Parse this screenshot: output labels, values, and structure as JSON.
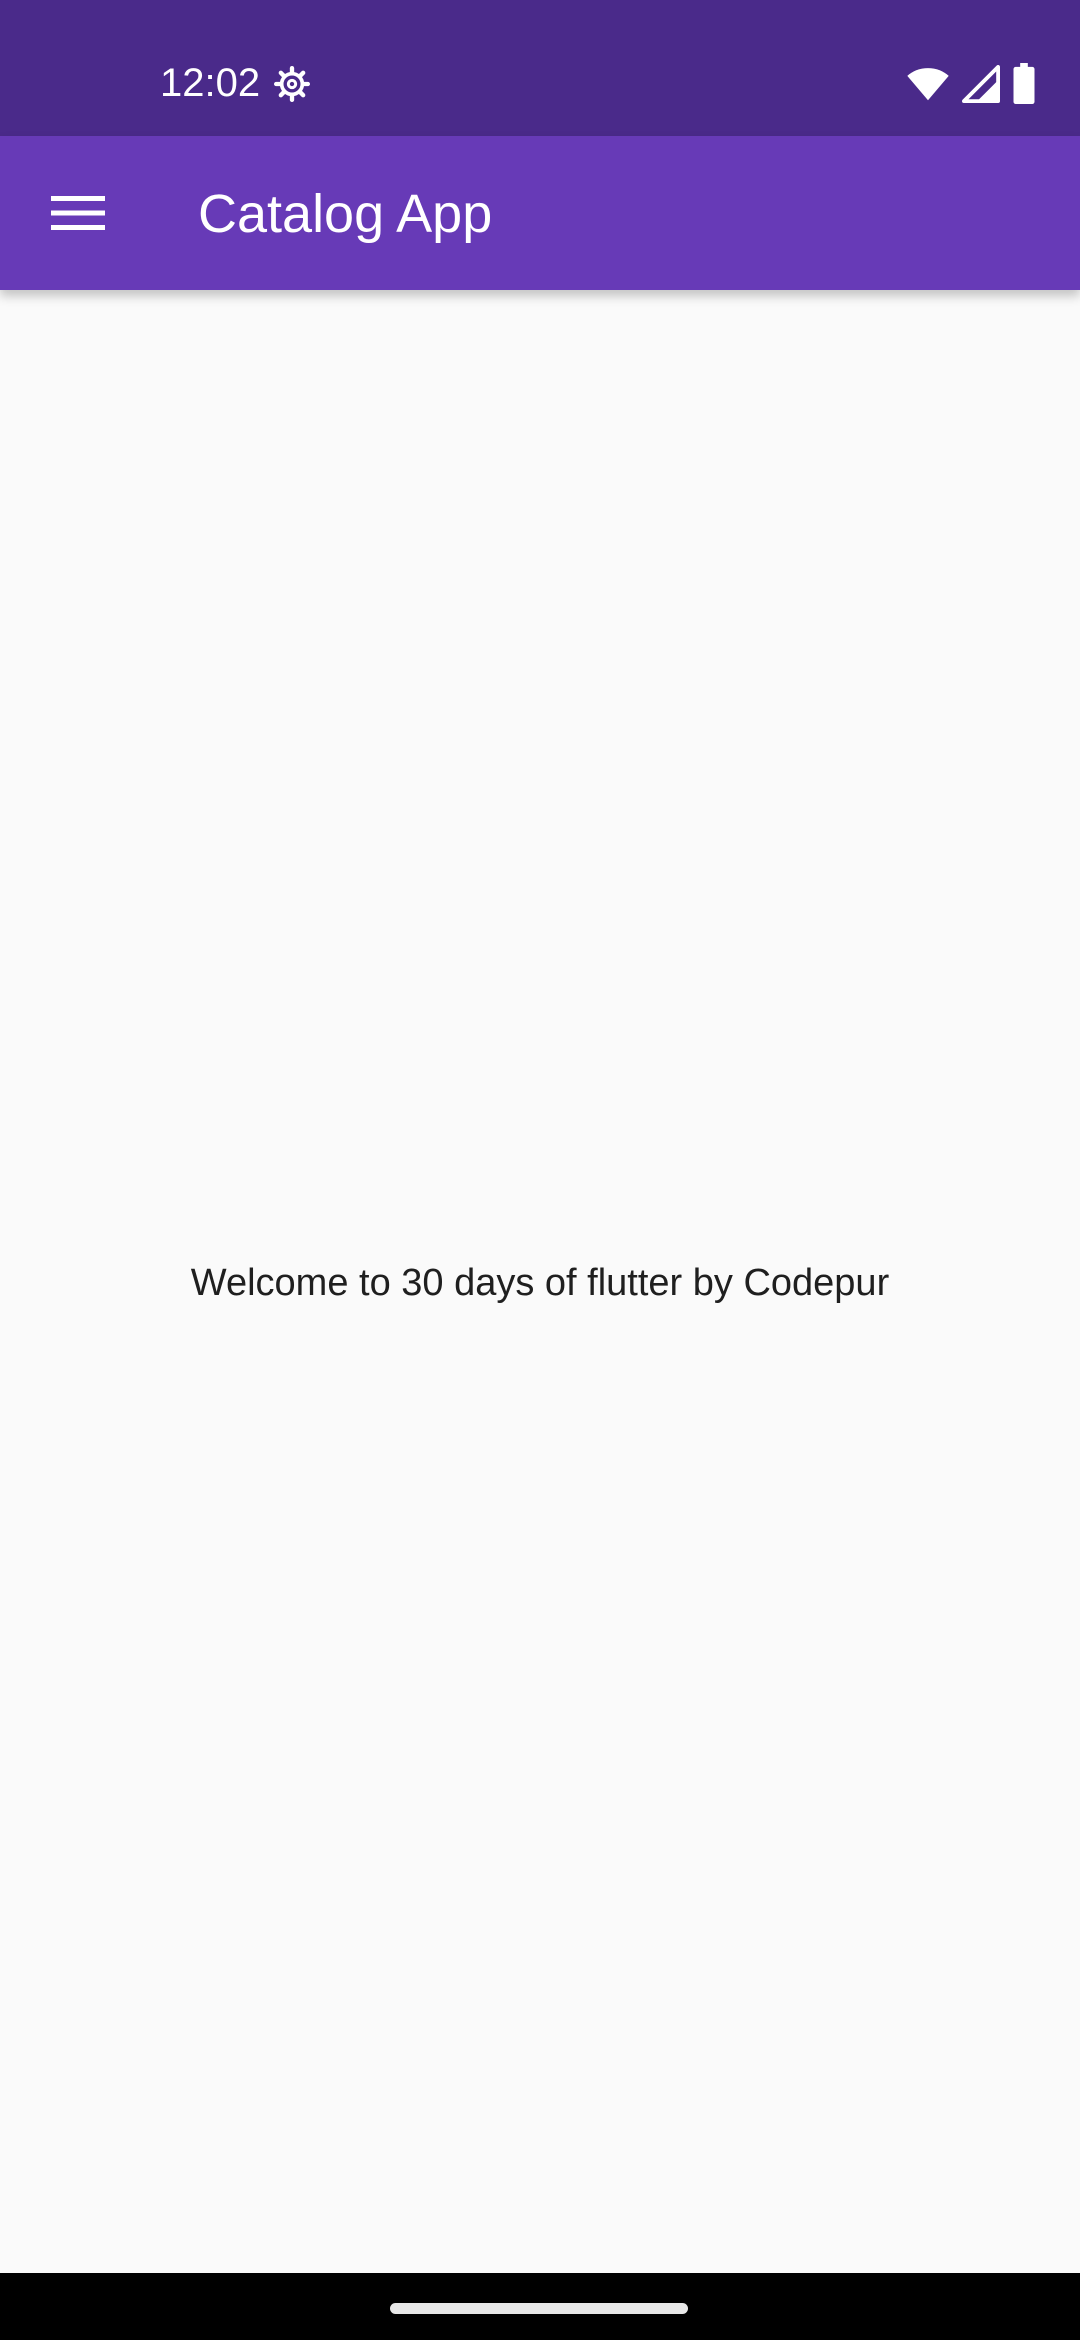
{
  "status_bar": {
    "time": "12:02",
    "icons": [
      "settings-gear-icon",
      "wifi-icon",
      "cellular-signal-icon",
      "battery-icon"
    ]
  },
  "app_bar": {
    "title": "Catalog App",
    "menu_icon": "menu-icon"
  },
  "body": {
    "welcome_text": "Welcome to 30 days of flutter by Codepur"
  },
  "colors": {
    "status_bar": "#4a2a8a",
    "app_bar": "#673ab7",
    "background": "#fafafa",
    "text": "#1f1f1f"
  }
}
